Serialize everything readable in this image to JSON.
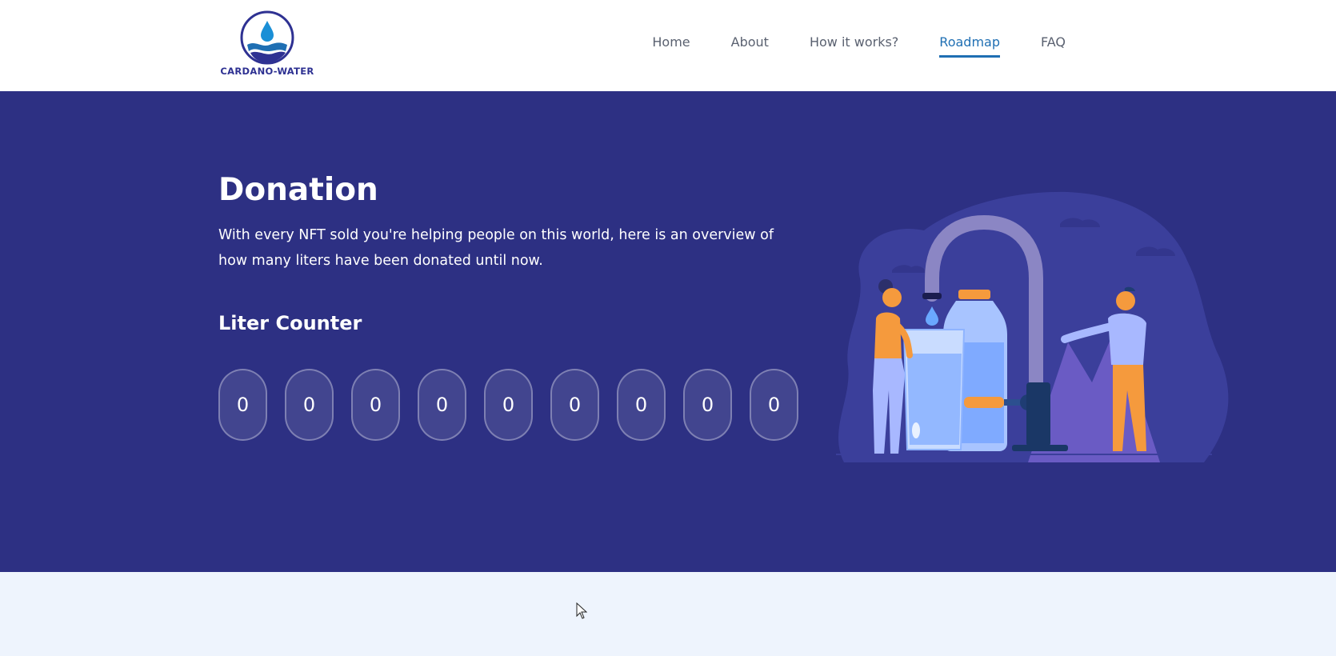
{
  "brand": {
    "name": "CARDANO-WATER"
  },
  "nav": {
    "items": [
      {
        "label": "Home",
        "active": false
      },
      {
        "label": "About",
        "active": false
      },
      {
        "label": "How it works?",
        "active": false
      },
      {
        "label": "Roadmap",
        "active": true
      },
      {
        "label": "FAQ",
        "active": false
      }
    ]
  },
  "hero": {
    "title": "Donation",
    "description": "With every NFT sold you're helping people on this world, here is an overview of how many liters have been donated until now.",
    "counter_title": "Liter Counter",
    "counter_digits": [
      "0",
      "0",
      "0",
      "0",
      "0",
      "0",
      "0",
      "0",
      "0"
    ]
  },
  "colors": {
    "hero_bg": "#2d3083",
    "nav_active": "#1f6fb3",
    "page_bg": "#eef4fd",
    "accent_orange": "#f59a3d"
  },
  "icons": {
    "logo": "water-drop-logo-icon",
    "illustration": "water-donation-illustration",
    "cursor": "mouse-pointer-icon"
  }
}
